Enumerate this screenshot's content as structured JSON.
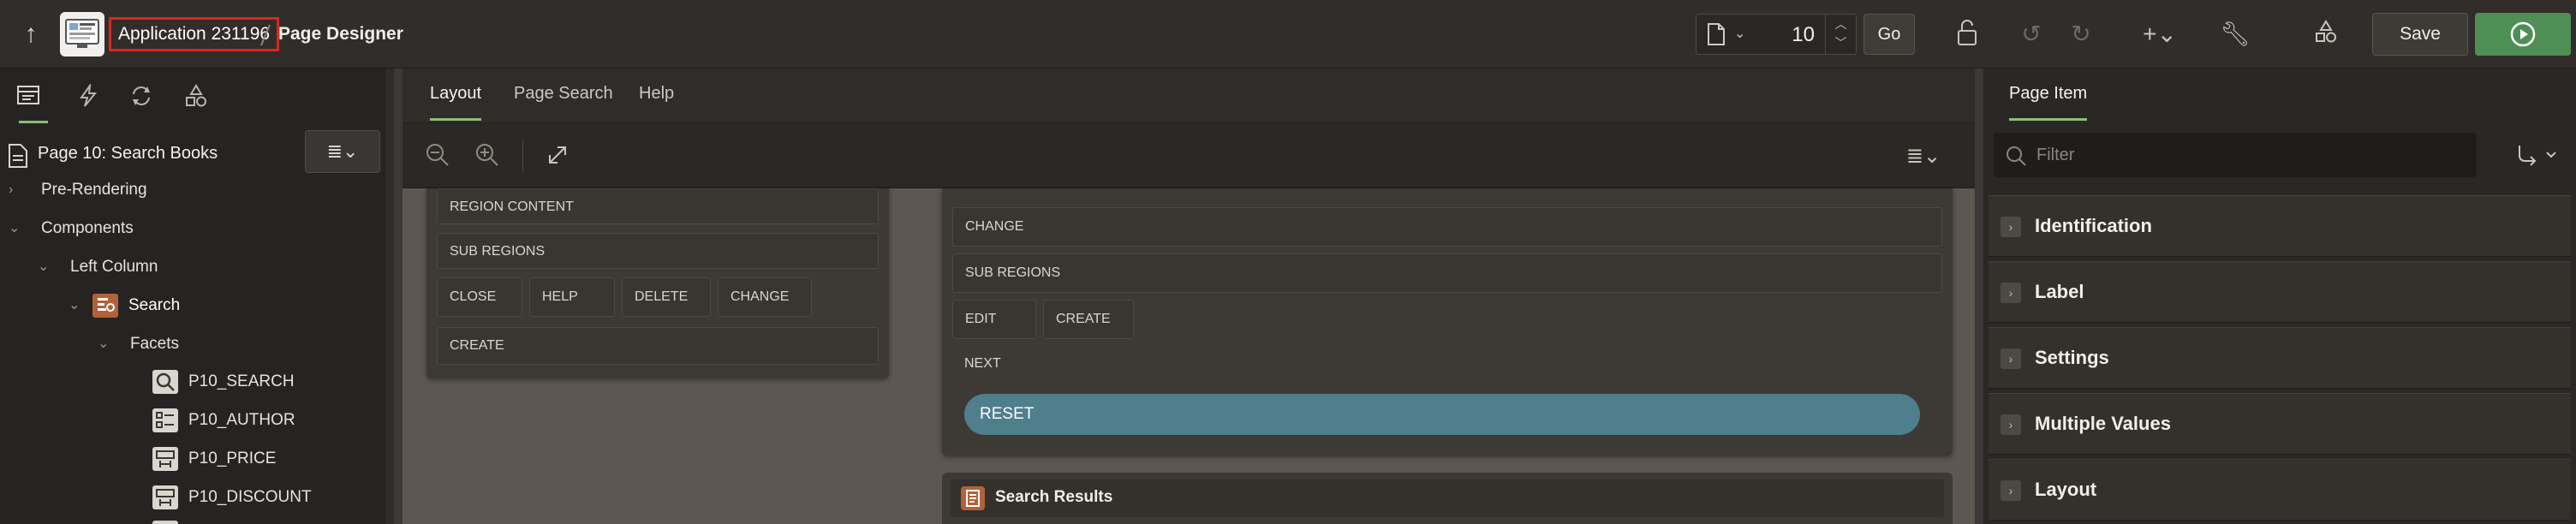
{
  "header": {
    "app_name": "Application 231196",
    "page_designer": "Page Designer",
    "page_number": "10",
    "go_label": "Go",
    "save_label": "Save"
  },
  "left_panel": {
    "page_title": "Page 10: Search Books",
    "tree": {
      "pre_rendering": "Pre-Rendering",
      "components": "Components",
      "left_column": "Left Column",
      "search": "Search",
      "facets": "Facets",
      "items": [
        "P10_SEARCH",
        "P10_AUTHOR",
        "P10_PRICE",
        "P10_DISCOUNT"
      ]
    }
  },
  "center": {
    "tabs": [
      "Layout",
      "Page Search",
      "Help"
    ],
    "left_card": {
      "region_content": "REGION CONTENT",
      "sub_regions": "SUB REGIONS",
      "buttons": [
        "CLOSE",
        "HELP",
        "DELETE",
        "CHANGE"
      ],
      "create": "CREATE"
    },
    "right_card": {
      "change": "CHANGE",
      "sub_regions": "SUB REGIONS",
      "buttons": [
        "EDIT",
        "CREATE"
      ],
      "next": "NEXT",
      "reset": "RESET"
    },
    "search_results": "Search Results"
  },
  "right_panel": {
    "tab": "Page Item",
    "filter_placeholder": "Filter",
    "sections": [
      "Identification",
      "Label",
      "Settings",
      "Multiple Values",
      "Layout"
    ]
  },
  "colors": {
    "accent_green": "#8bbf7a",
    "run_green": "#4f8f56",
    "reset_teal": "#4f7e8c",
    "highlight_red": "#d8281f"
  }
}
